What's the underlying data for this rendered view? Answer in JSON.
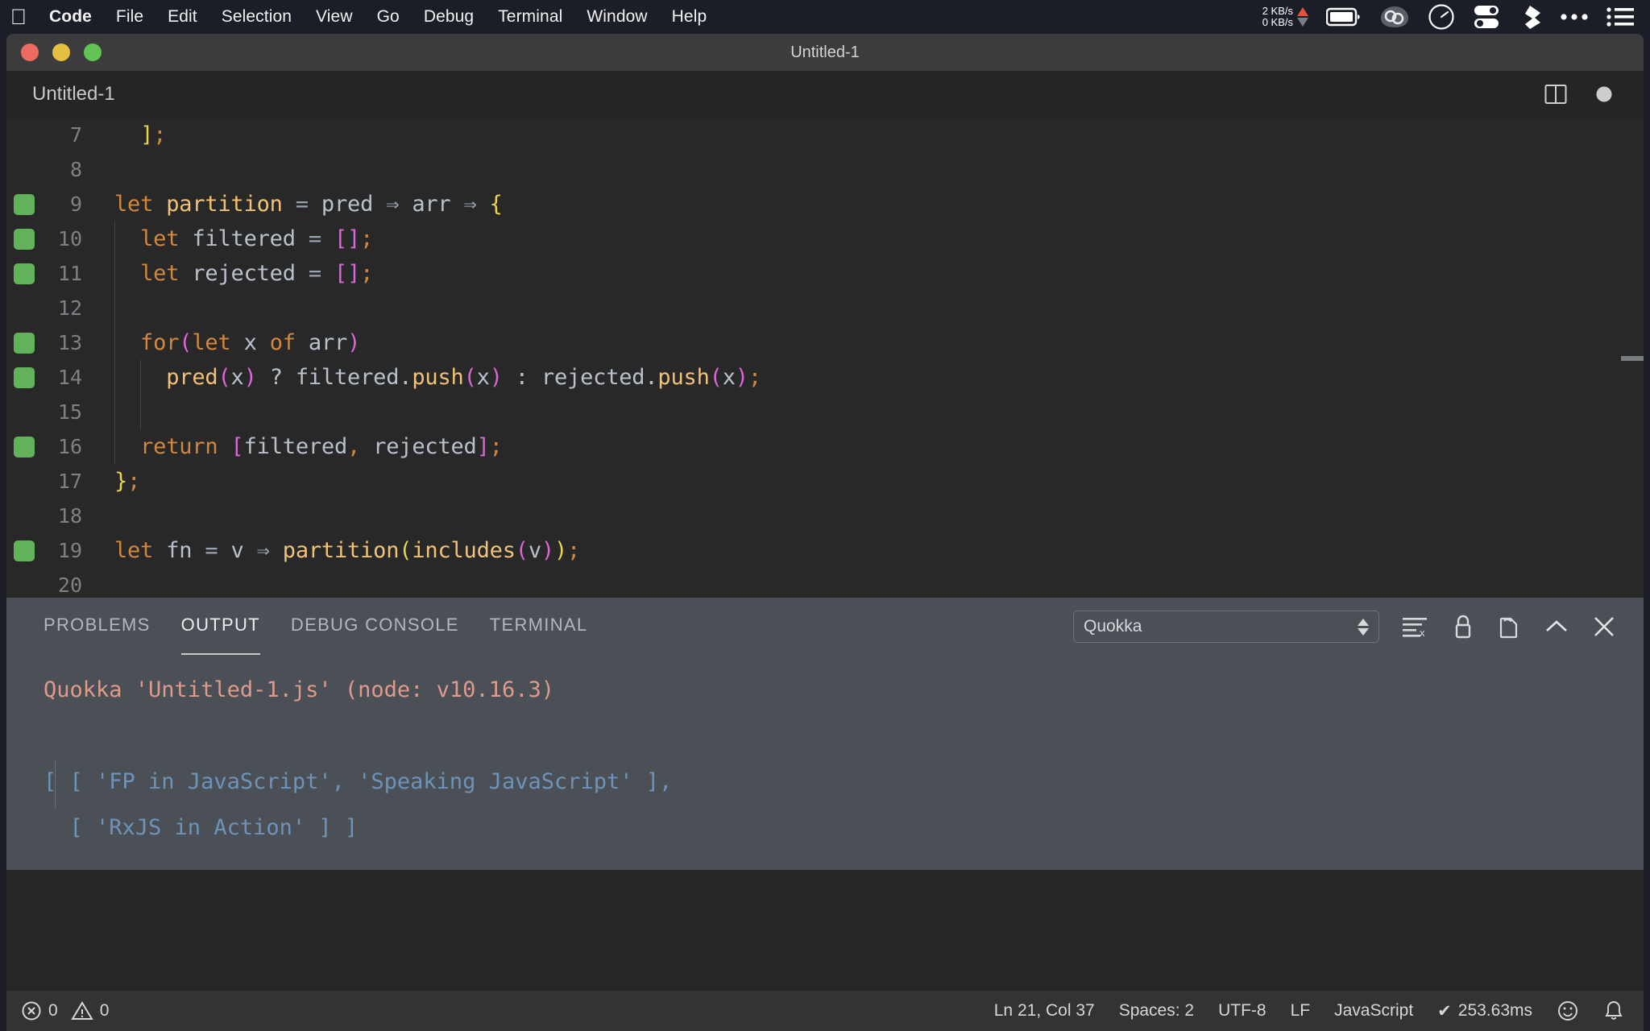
{
  "menubar": {
    "apple_icon": "apple-logo-icon",
    "items": [
      {
        "label": "Code",
        "bold": true
      },
      {
        "label": "File",
        "bold": false
      },
      {
        "label": "Edit",
        "bold": false
      },
      {
        "label": "Selection",
        "bold": false
      },
      {
        "label": "View",
        "bold": false
      },
      {
        "label": "Go",
        "bold": false
      },
      {
        "label": "Debug",
        "bold": false
      },
      {
        "label": "Terminal",
        "bold": false
      },
      {
        "label": "Window",
        "bold": false
      },
      {
        "label": "Help",
        "bold": false
      }
    ],
    "network": {
      "upload": "2 KB/s",
      "download": "0 KB/s",
      "up_arrow_color": "#e8503a",
      "down_arrow_color": "#7a7d86"
    },
    "status_icons": [
      "battery-icon",
      "vpn-icon",
      "speedometer-icon",
      "toggles-icon",
      "dropbox-icon",
      "ellipsis-icon",
      "list-menu-icon"
    ]
  },
  "window": {
    "title": "Untitled-1",
    "traffic_lights": {
      "close": "#ec6a5f",
      "minimize": "#e4bf41",
      "maximize": "#61c454"
    }
  },
  "editor": {
    "tab_label": "Untitled-1",
    "actions": [
      "split-editor-icon",
      "unsaved-dot-icon"
    ],
    "lines": [
      {
        "num": "7",
        "quokka": false,
        "indent_guides": 0,
        "tokens": [
          {
            "t": "  ",
            "c": "plain"
          },
          {
            "t": "]",
            "c": "brk-y"
          },
          {
            "t": ";",
            "c": "brk-o"
          }
        ]
      },
      {
        "num": "8",
        "quokka": false,
        "indent_guides": 0,
        "tokens": []
      },
      {
        "num": "9",
        "quokka": true,
        "indent_guides": 0,
        "tokens": [
          {
            "t": "let",
            "c": "kw"
          },
          {
            "t": " ",
            "c": "plain"
          },
          {
            "t": "partition",
            "c": "fname"
          },
          {
            "t": " ",
            "c": "plain"
          },
          {
            "t": "=",
            "c": "op"
          },
          {
            "t": " pred ",
            "c": "plain"
          },
          {
            "t": "⇒",
            "c": "op"
          },
          {
            "t": " arr ",
            "c": "plain"
          },
          {
            "t": "⇒",
            "c": "op"
          },
          {
            "t": " ",
            "c": "plain"
          },
          {
            "t": "{",
            "c": "brk-y"
          }
        ]
      },
      {
        "num": "10",
        "quokka": true,
        "indent_guides": 1,
        "tokens": [
          {
            "t": "  ",
            "c": "plain"
          },
          {
            "t": "let",
            "c": "kw"
          },
          {
            "t": " filtered ",
            "c": "plain"
          },
          {
            "t": "=",
            "c": "op"
          },
          {
            "t": " ",
            "c": "plain"
          },
          {
            "t": "[]",
            "c": "brk-m"
          },
          {
            "t": ";",
            "c": "brk-o"
          }
        ]
      },
      {
        "num": "11",
        "quokka": true,
        "indent_guides": 1,
        "tokens": [
          {
            "t": "  ",
            "c": "plain"
          },
          {
            "t": "let",
            "c": "kw"
          },
          {
            "t": " rejected ",
            "c": "plain"
          },
          {
            "t": "=",
            "c": "op"
          },
          {
            "t": " ",
            "c": "plain"
          },
          {
            "t": "[]",
            "c": "brk-m"
          },
          {
            "t": ";",
            "c": "brk-o"
          }
        ]
      },
      {
        "num": "12",
        "quokka": false,
        "indent_guides": 1,
        "tokens": []
      },
      {
        "num": "13",
        "quokka": true,
        "indent_guides": 1,
        "tokens": [
          {
            "t": "  ",
            "c": "plain"
          },
          {
            "t": "for",
            "c": "kw"
          },
          {
            "t": "(",
            "c": "brk-m"
          },
          {
            "t": "let",
            "c": "kw"
          },
          {
            "t": " x ",
            "c": "plain"
          },
          {
            "t": "of",
            "c": "kw"
          },
          {
            "t": " arr",
            "c": "plain"
          },
          {
            "t": ")",
            "c": "brk-m"
          }
        ]
      },
      {
        "num": "14",
        "quokka": true,
        "indent_guides": 2,
        "tokens": [
          {
            "t": "    ",
            "c": "plain"
          },
          {
            "t": "pred",
            "c": "fname"
          },
          {
            "t": "(",
            "c": "brk-m"
          },
          {
            "t": "x",
            "c": "plain"
          },
          {
            "t": ")",
            "c": "brk-m"
          },
          {
            "t": " ? filtered.",
            "c": "plain"
          },
          {
            "t": "push",
            "c": "fname"
          },
          {
            "t": "(",
            "c": "brk-m"
          },
          {
            "t": "x",
            "c": "plain"
          },
          {
            "t": ")",
            "c": "brk-m"
          },
          {
            "t": " : rejected.",
            "c": "plain"
          },
          {
            "t": "push",
            "c": "fname"
          },
          {
            "t": "(",
            "c": "brk-m"
          },
          {
            "t": "x",
            "c": "plain"
          },
          {
            "t": ")",
            "c": "brk-m"
          },
          {
            "t": ";",
            "c": "brk-o"
          }
        ]
      },
      {
        "num": "15",
        "quokka": false,
        "indent_guides": 2,
        "tokens": []
      },
      {
        "num": "16",
        "quokka": true,
        "indent_guides": 1,
        "tokens": [
          {
            "t": "  ",
            "c": "plain"
          },
          {
            "t": "return",
            "c": "kw"
          },
          {
            "t": " ",
            "c": "plain"
          },
          {
            "t": "[",
            "c": "brk-m"
          },
          {
            "t": "filtered",
            "c": "plain"
          },
          {
            "t": ",",
            "c": "brk-o"
          },
          {
            "t": " rejected",
            "c": "plain"
          },
          {
            "t": "]",
            "c": "brk-m"
          },
          {
            "t": ";",
            "c": "brk-o"
          }
        ]
      },
      {
        "num": "17",
        "quokka": false,
        "indent_guides": 0,
        "tokens": [
          {
            "t": "}",
            "c": "brk-y"
          },
          {
            "t": ";",
            "c": "brk-o"
          }
        ]
      },
      {
        "num": "18",
        "quokka": false,
        "indent_guides": 0,
        "tokens": []
      },
      {
        "num": "19",
        "quokka": true,
        "indent_guides": 0,
        "tokens": [
          {
            "t": "let",
            "c": "kw"
          },
          {
            "t": " fn ",
            "c": "plain"
          },
          {
            "t": "=",
            "c": "op"
          },
          {
            "t": " v ",
            "c": "plain"
          },
          {
            "t": "⇒",
            "c": "op"
          },
          {
            "t": " ",
            "c": "plain"
          },
          {
            "t": "partition",
            "c": "fname"
          },
          {
            "t": "(",
            "c": "brk-y"
          },
          {
            "t": "includes",
            "c": "fname"
          },
          {
            "t": "(",
            "c": "brk-m"
          },
          {
            "t": "v",
            "c": "plain"
          },
          {
            "t": ")",
            "c": "brk-m"
          },
          {
            "t": ")",
            "c": "brk-y"
          },
          {
            "t": ";",
            "c": "brk-o"
          }
        ]
      },
      {
        "num": "20",
        "quokka": false,
        "indent_guides": 0,
        "tokens": []
      }
    ]
  },
  "panel": {
    "tabs": [
      {
        "label": "PROBLEMS",
        "active": false
      },
      {
        "label": "OUTPUT",
        "active": true
      },
      {
        "label": "DEBUG CONSOLE",
        "active": false
      },
      {
        "label": "TERMINAL",
        "active": false
      }
    ],
    "channel_select": {
      "value": "Quokka"
    },
    "actions": [
      "clear-output-icon",
      "lock-scroll-icon",
      "open-in-editor-icon",
      "collapse-panel-icon",
      "close-panel-icon"
    ],
    "output": [
      {
        "text": "Quokka 'Untitled-1.js' (node: v10.16.3)",
        "style": "head"
      },
      {
        "text": "",
        "style": "val"
      },
      {
        "text": "[ [ 'FP in JavaScript', 'Speaking JavaScript' ],",
        "style": "val"
      },
      {
        "text": "  [ 'RxJS in Action' ] ]",
        "style": "val"
      }
    ]
  },
  "statusbar": {
    "errors": "0",
    "warnings": "0",
    "cursor": "Ln 21, Col 37",
    "spaces": "Spaces: 2",
    "encoding": "UTF-8",
    "eol": "LF",
    "language": "JavaScript",
    "quokka_time": "253.63ms",
    "quokka_check": "✔",
    "feedback_icon": "smiley-icon",
    "notifications_icon": "bell-icon"
  }
}
